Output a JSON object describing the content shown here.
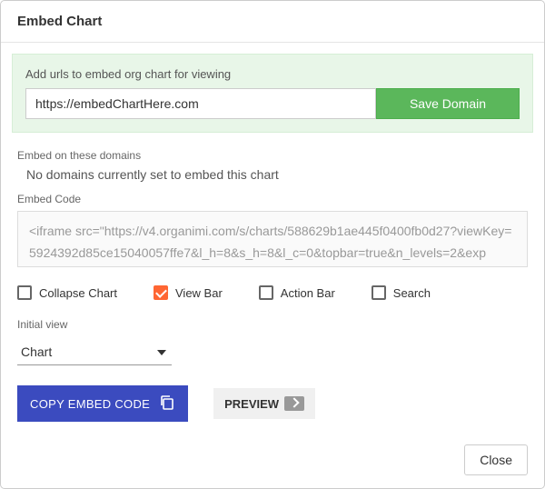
{
  "header": {
    "title": "Embed Chart"
  },
  "green": {
    "label": "Add urls to embed org chart for viewing",
    "url_value": "https://embedChartHere.com",
    "save_label": "Save Domain"
  },
  "domains": {
    "heading": "Embed on these domains",
    "empty": "No domains currently set to embed this chart"
  },
  "embed": {
    "heading": "Embed Code",
    "code": "<iframe src=\"https://v4.organimi.com/s/charts/588629b1ae445f0400fb0d27?viewKey=5924392d85ce15040057ffe7&l_h=8&s_h=8&l_c=0&topbar=true&n_levels=2&exp"
  },
  "checkboxes": {
    "collapse": "Collapse Chart",
    "viewbar": "View Bar",
    "actionbar": "Action Bar",
    "search": "Search"
  },
  "initial": {
    "label": "Initial view",
    "value": "Chart"
  },
  "buttons": {
    "copy": "COPY EMBED CODE",
    "preview": "PREVIEW",
    "close": "Close"
  }
}
